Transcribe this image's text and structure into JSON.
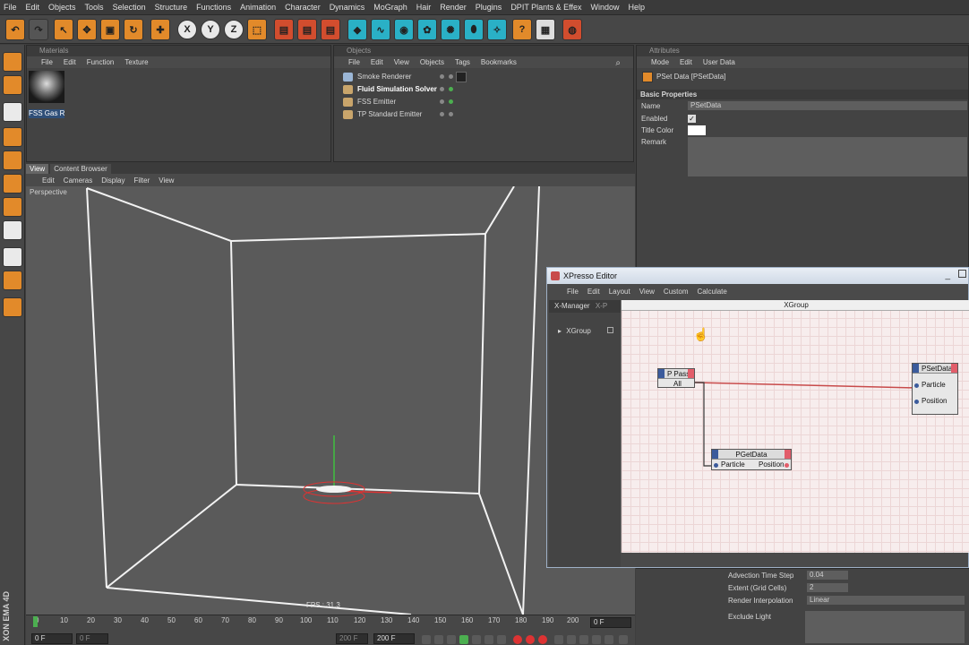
{
  "menubar": [
    "File",
    "Edit",
    "Objects",
    "Tools",
    "Selection",
    "Structure",
    "Functions",
    "Animation",
    "Character",
    "Dynamics",
    "MoGraph",
    "Hair",
    "Render",
    "Plugins",
    "DPIT Plants & Effex",
    "Window",
    "Help"
  ],
  "materials": {
    "title": "Materials",
    "menu": [
      "File",
      "Edit",
      "Function",
      "Texture"
    ],
    "item_label": "FSS Gas Re"
  },
  "objects": {
    "title": "Objects",
    "menu": [
      "File",
      "Edit",
      "View",
      "Objects",
      "Tags",
      "Bookmarks"
    ],
    "items": [
      "Smoke Renderer",
      "Fluid Simulation Solver",
      "FSS Emitter",
      "TP Standard Emitter"
    ]
  },
  "attributes": {
    "title": "Attributes",
    "menu": [
      "Mode",
      "Edit",
      "User Data"
    ],
    "object_name": "PSet Data [PSetData]",
    "section": "Basic Properties",
    "name_label": "Name",
    "name_value": "PSetData",
    "enabled_label": "Enabled",
    "title_color_label": "Title Color",
    "remark_label": "Remark"
  },
  "viewport": {
    "tabs": [
      "View",
      "Content Browser"
    ],
    "menu": [
      "Edit",
      "Cameras",
      "Display",
      "Filter",
      "View"
    ],
    "label": "Perspective",
    "fps": "FPS : 31.3"
  },
  "timeline": {
    "ticks": [
      "0",
      "10",
      "20",
      "30",
      "40",
      "50",
      "60",
      "70",
      "80",
      "90",
      "100",
      "110",
      "120",
      "130",
      "140",
      "150",
      "160",
      "170",
      "180",
      "190",
      "200"
    ],
    "current_frame": "0 F",
    "start_frame": "0 F",
    "start_frame2": "0 F",
    "end_frame": "200 F",
    "end_frame2": "200 F"
  },
  "xpresso": {
    "title": "XPresso Editor",
    "menu": [
      "File",
      "Edit",
      "Layout",
      "View",
      "Custom",
      "Calculate"
    ],
    "manager_tab": "X-Manager",
    "manager_tab2": "X-P",
    "group_item": "XGroup",
    "graph_title": "XGroup",
    "node_ppass": {
      "title": "P Pass",
      "port": "All"
    },
    "node_psetdata": {
      "title": "PSetData",
      "port1": "Particle",
      "port2": "Position"
    },
    "node_pgetdata": {
      "title": "PGetData",
      "port1": "Particle",
      "port2": "Position"
    }
  },
  "lower_attributes": [
    {
      "label": "Advection Time Step",
      "value": "0.04"
    },
    {
      "label": "Extent (Grid Cells)",
      "value": "2"
    },
    {
      "label": "Render Interpolation",
      "value": "Linear"
    },
    {
      "label": "Exclude Light",
      "value": ""
    }
  ],
  "vendor_text": "XON EMA 4D",
  "colors": {
    "accent_orange": "#e28a2a",
    "selection_blue": "#2f4f78",
    "xpresso_bg": "#f7eded",
    "wire_red": "#c84a4a"
  }
}
